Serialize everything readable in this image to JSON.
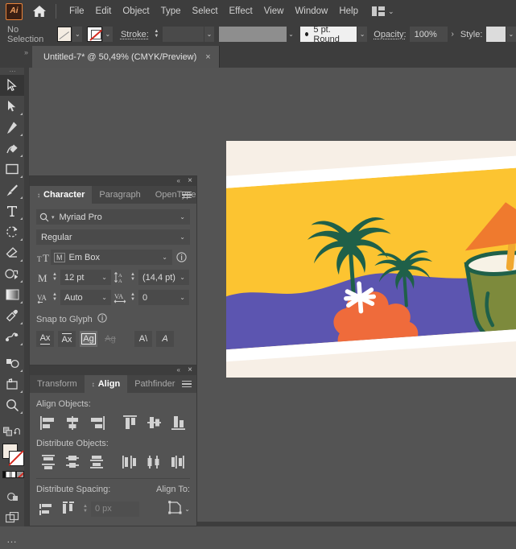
{
  "app": {
    "name": "Adobe Illustrator",
    "logo_text": "Ai",
    "home_icon": "home-icon",
    "workspace_switcher_icon": "workspace-layout-icon",
    "workspace_caret": "⌄"
  },
  "menubar": {
    "items": [
      {
        "label": "File"
      },
      {
        "label": "Edit"
      },
      {
        "label": "Object"
      },
      {
        "label": "Type"
      },
      {
        "label": "Select"
      },
      {
        "label": "Effect"
      },
      {
        "label": "View"
      },
      {
        "label": "Window"
      },
      {
        "label": "Help"
      }
    ]
  },
  "control_bar": {
    "selection_status": "No Selection",
    "fill_swatch_name": "fill-color-swatch",
    "fill_caret": "⌄",
    "stroke_swatch_name": "stroke-none-swatch",
    "stroke_caret": "⌄",
    "stroke_label": "Stroke:",
    "stroke_weight_value": "",
    "stroke_weight_caret": "⌄",
    "stroke_profile_value": "",
    "stroke_profile_caret": "⌄",
    "brush_value": "5 pt. Round",
    "brush_caret": "⌄",
    "opacity_label": "Opacity:",
    "opacity_value": "100%",
    "opacity_more": "›",
    "style_label": "Style:",
    "style_caret": "⌄"
  },
  "tabbar": {
    "document_title": "Untitled-7* @ 50,49% (CMYK/Preview)",
    "close_glyph": "×",
    "dock_grip": "»"
  },
  "toolbar": {
    "grip": "⋯",
    "tools": [
      {
        "name": "selection-tool",
        "glyph": "selection",
        "selected": true
      },
      {
        "name": "direct-selection-tool",
        "glyph": "direct-selection",
        "selected": false
      },
      {
        "name": "pen-tool",
        "glyph": "pen",
        "selected": false
      },
      {
        "name": "curvature-tool",
        "glyph": "curvature",
        "selected": false
      },
      {
        "name": "rectangle-tool",
        "glyph": "rectangle",
        "selected": false
      },
      {
        "name": "paintbrush-tool",
        "glyph": "paintbrush",
        "selected": false
      },
      {
        "name": "type-tool",
        "glyph": "type",
        "selected": false
      },
      {
        "name": "rotate-tool",
        "glyph": "rotate",
        "selected": false
      },
      {
        "name": "eraser-tool",
        "glyph": "eraser",
        "selected": false
      },
      {
        "name": "shape-builder-tool",
        "glyph": "shape-builder",
        "selected": false
      },
      {
        "name": "gradient-tool",
        "glyph": "gradient",
        "selected": false
      },
      {
        "name": "eyedropper-tool",
        "glyph": "eyedropper",
        "selected": false
      },
      {
        "name": "blend-tool",
        "glyph": "blend",
        "selected": false
      },
      {
        "name": "symbol-sprayer-tool",
        "glyph": "symbol-sprayer",
        "selected": false
      },
      {
        "name": "artboard-tool",
        "glyph": "artboard",
        "selected": false
      },
      {
        "name": "zoom-tool",
        "glyph": "zoom",
        "selected": false
      }
    ],
    "fill_stroke": {
      "fill_color": "#f4ece2",
      "stroke_color": "#ffffff",
      "stroke_is_none": true,
      "swap_icon": "swap-fill-stroke-icon",
      "default_icon": "default-fill-stroke-icon"
    },
    "screen_mode_icon": "screen-mode-icon",
    "arrange_icon": "arrange-documents-icon",
    "more_tools": "…"
  },
  "character_panel": {
    "collapse_glyph": "«",
    "close_glyph": "×",
    "menu_icon": "panel-menu-icon",
    "tabs": [
      {
        "label": "Character",
        "active": true
      },
      {
        "label": "Paragraph",
        "active": false
      },
      {
        "label": "OpenType",
        "active": false
      }
    ],
    "font_family": "Myriad Pro",
    "font_style": "Regular",
    "font_family_search_icon": "font-search-icon",
    "metric_mode": "Em Box",
    "metric_info_icon": "info-icon",
    "font_size_label_icon": "font-size-icon",
    "font_size": "12 pt",
    "leading_label_icon": "leading-icon",
    "leading": "(14,4 pt)",
    "kerning_label_icon": "kerning-icon",
    "kerning": "Auto",
    "tracking_label_icon": "tracking-icon",
    "tracking": "0",
    "snap_to_glyph_label": "Snap to Glyph",
    "snap_info_icon": "info-icon",
    "snap_buttons": [
      {
        "name": "snap-baseline",
        "glyph": "Ax",
        "state": "normal"
      },
      {
        "name": "snap-x-height",
        "glyph": "Ax",
        "state": "normal"
      },
      {
        "name": "snap-em-box",
        "glyph": "Ag",
        "state": "active"
      },
      {
        "name": "snap-descender",
        "glyph": "Ag",
        "state": "disabled"
      },
      {
        "name": "snap-angle-guide",
        "glyph": "A\\",
        "state": "normal"
      },
      {
        "name": "snap-italic-guide",
        "glyph": "A",
        "state": "normal"
      }
    ],
    "dropdown_caret": "⌄"
  },
  "align_panel": {
    "collapse_glyph": "«",
    "close_glyph": "×",
    "menu_icon": "panel-menu-icon",
    "tabs": [
      {
        "label": "Transform",
        "active": false
      },
      {
        "label": "Align",
        "active": true
      },
      {
        "label": "Pathfinder",
        "active": false
      }
    ],
    "align_objects_label": "Align Objects:",
    "align_buttons": [
      {
        "name": "align-left-edges"
      },
      {
        "name": "align-horizontal-center"
      },
      {
        "name": "align-right-edges"
      },
      {
        "name": "align-top-edges"
      },
      {
        "name": "align-vertical-center"
      },
      {
        "name": "align-bottom-edges"
      }
    ],
    "distribute_objects_label": "Distribute Objects:",
    "distribute_buttons": [
      {
        "name": "distribute-top-edges"
      },
      {
        "name": "distribute-vertical-centers"
      },
      {
        "name": "distribute-bottom-edges"
      },
      {
        "name": "distribute-left-edges"
      },
      {
        "name": "distribute-horizontal-centers"
      },
      {
        "name": "distribute-right-edges"
      }
    ],
    "distribute_spacing_label": "Distribute Spacing:",
    "spacing_buttons": [
      {
        "name": "distribute-vertical-space"
      },
      {
        "name": "distribute-horizontal-space"
      }
    ],
    "spacing_value": "0 px",
    "align_to_label": "Align To:",
    "align_to_icon": "align-to-selection-icon",
    "align_to_caret": "⌄"
  },
  "artwork": {
    "description": "tropical postcard illustration",
    "canvas_background": "#545454",
    "artboard_background": "#f7efe6",
    "colors": {
      "sky": "#fcc431",
      "sea": "#5c55b0",
      "flower": "#ef6b3b",
      "palm": "#1f6049",
      "coconut": "#7d8a3c",
      "coconut_rim": "#f7f2e6",
      "umbrella": "#ef7a2e",
      "straw": "#f0a830",
      "border": "#ffffff"
    }
  }
}
